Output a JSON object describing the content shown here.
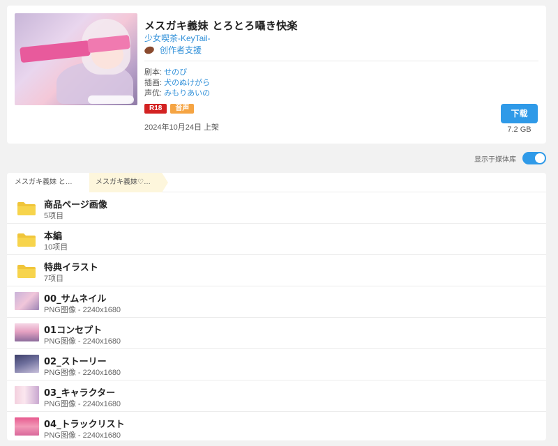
{
  "work": {
    "title": "メスガキ義妹 とろとろ囁き快楽",
    "circle": "少女喫茶-KeyTail-",
    "support_label": "创作者支援",
    "credits": [
      {
        "label": "剧本:",
        "value": "せのび"
      },
      {
        "label": "插画:",
        "value": "犬のぬけがら"
      },
      {
        "label": "声优:",
        "value": "みもりあいの"
      }
    ],
    "tags": [
      "R18",
      "音声"
    ],
    "release": "2024年10月24日 上架",
    "download_label": "下载",
    "size": "7.2 GB"
  },
  "library_toggle": {
    "label": "显示于媒体库",
    "on": true
  },
  "breadcrumbs": [
    "メスガキ義妹 と…",
    "メスガキ義妹♡…"
  ],
  "files": [
    {
      "type": "folder",
      "name": "商品ページ画像",
      "meta": "5项目"
    },
    {
      "type": "folder",
      "name": "本編",
      "meta": "10项目"
    },
    {
      "type": "folder",
      "name": "特典イラスト",
      "meta": "7项目"
    },
    {
      "type": "image",
      "name": "00_サムネイル",
      "meta": "PNG图像 - 2240x1680"
    },
    {
      "type": "image",
      "name": "01コンセプト",
      "meta": "PNG图像 - 2240x1680"
    },
    {
      "type": "image",
      "name": "02_ストーリー",
      "meta": "PNG图像 - 2240x1680"
    },
    {
      "type": "image",
      "name": "03_キャラクター",
      "meta": "PNG图像 - 2240x1680"
    },
    {
      "type": "image",
      "name": "04_トラックリスト",
      "meta": "PNG图像 - 2240x1680"
    }
  ],
  "colors": {
    "accent": "#2f9ae8",
    "link": "#2f8fd8",
    "r18": "#d32222",
    "voice": "#f5a443",
    "folder": "#f7d44c"
  },
  "icons": {
    "folder": "folder-icon",
    "support": "football-icon"
  }
}
